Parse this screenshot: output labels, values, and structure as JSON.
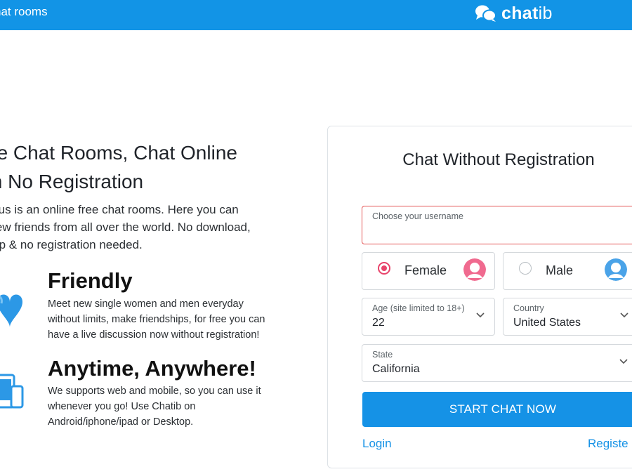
{
  "header": {
    "nav_text": "hat rooms",
    "brand_bold": "chat",
    "brand_light": "ib",
    "color": "#1294e6"
  },
  "hero": {
    "title_line1": "ee Chat Rooms, Chat Online",
    "title_line2": "th No Registration",
    "desc_line1": "tib.us is an online free chat rooms. Here you can",
    "desc_line2": "t new friends from all over the world. No download,",
    "desc_line3": "etup & no registration needed."
  },
  "features": [
    {
      "icon": "heart-icon",
      "title": "Friendly",
      "line1": "Meet new single women and men everyday",
      "line2": "without limits, make friendships, for free you can",
      "line3": "have a live discussion now without registration!"
    },
    {
      "icon": "devices-icon",
      "title": "Anytime, Anywhere!",
      "line1": "We supports web and mobile, so you can use it",
      "line2": "whenever you go! Use Chatib on",
      "line3": "Android/iphone/ipad or Desktop."
    }
  ],
  "form": {
    "title": "Chat Without Registration",
    "username_label": "Choose your username",
    "username_value": "",
    "gender_female": "Female",
    "gender_male": "Male",
    "selected_gender": "Female",
    "age_label": "Age (site limited to 18+)",
    "age_value": "22",
    "country_label": "Country",
    "country_value": "United States",
    "state_label": "State",
    "state_value": "California",
    "submit_label": "START CHAT NOW",
    "login_label": "Login",
    "register_label": "Registe"
  },
  "colors": {
    "accent": "#1592e6",
    "error_border": "#e45555",
    "female_radio": "#e8436a",
    "female_avatar": "#f06a8f",
    "male_avatar": "#4aa3e8"
  }
}
